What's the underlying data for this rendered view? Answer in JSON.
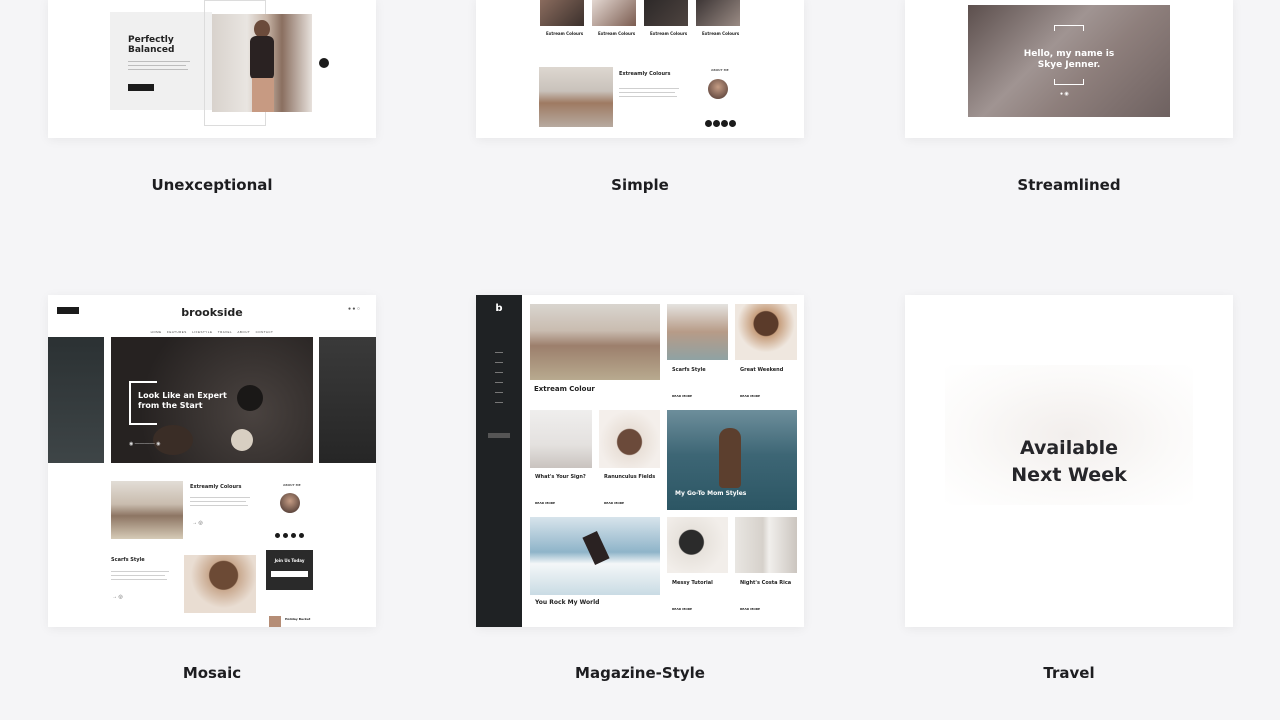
{
  "themes": [
    {
      "name": "Unexceptional",
      "preview": {
        "heading": "Perfectly Balanced"
      }
    },
    {
      "name": "Simple",
      "preview": {
        "post_titles": [
          "Extream Colours",
          "Extream Colours",
          "Extream Colours",
          "Extream Colours"
        ],
        "featured_title": "Extreamly Colours",
        "widget_label": "ABOUT ME"
      }
    },
    {
      "name": "Streamlined",
      "preview": {
        "hero_text_line1": "Hello, my name is",
        "hero_text_line2": "Skye Jenner."
      }
    },
    {
      "name": "Mosaic",
      "preview": {
        "logo": "brookside",
        "nav": [
          "HOME",
          "FEATURES",
          "LIFESTYLE",
          "TRAVEL",
          "ABOUT",
          "CONTACT"
        ],
        "hero_line1": "Look Like an Expert",
        "hero_line2": "from the Start",
        "post1_title": "Extreamly Colours",
        "post2_title": "Scarfs Style",
        "widget_title": "Join Us Today",
        "recent_post": "Holiday Bucket"
      }
    },
    {
      "name": "Magazine-Style",
      "preview": {
        "logo": "b",
        "posts": [
          "Extream Colour",
          "Scarfs Style",
          "Great Weekend",
          "What's Your Sign?",
          "Ranunculus Fields",
          "My Go-To Mom Styles",
          "You Rock My World",
          "Messy Tutorial",
          "Night's Costa Rica"
        ],
        "read_more": "READ MORE"
      }
    },
    {
      "name": "Travel",
      "preview": {
        "overlay_line1": "Available",
        "overlay_line2": "Next Week"
      }
    }
  ]
}
